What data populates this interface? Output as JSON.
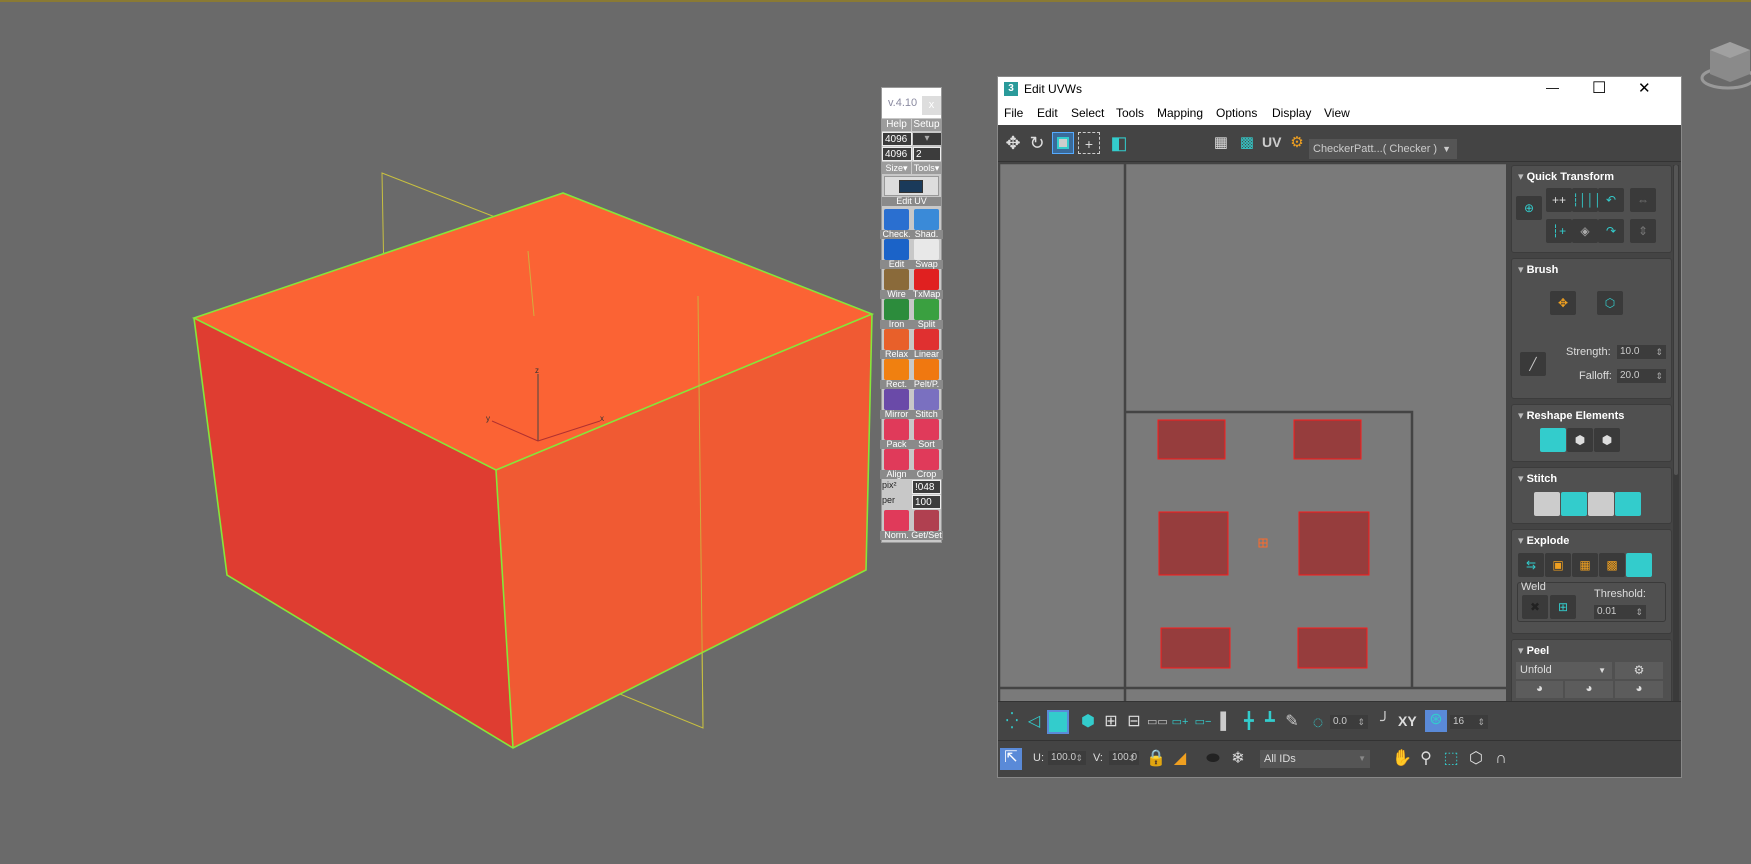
{
  "viewport": {
    "axis_labels": {
      "z": "z",
      "x": "x",
      "y": "y"
    },
    "box_color": "#f26036",
    "edge_color": "#7ee23a"
  },
  "plugin_toolbar": {
    "version": "v.4.10",
    "close": "x",
    "help": "Help",
    "setup": "Setup",
    "width_value": "4096",
    "height_value": "4096",
    "extra_value": "2",
    "size": "Size▾",
    "tools": "Tools▾",
    "edit_uv": "Edit  UV",
    "tools_grid": [
      {
        "label": "Check.",
        "icon": "checker-cube-icon",
        "color": "#2a6fd0"
      },
      {
        "label": "Shad.",
        "icon": "shaded-sphere-icon",
        "color": "#3a8ad8"
      },
      {
        "label": "Edit",
        "icon": "photoshop-icon",
        "color": "#1b63c8"
      },
      {
        "label": "Swap",
        "icon": "uv-3d-swap-icon",
        "color": "#e8e8e8"
      },
      {
        "label": "Wire",
        "icon": "clipboard-wire-icon",
        "color": "#8a6a3a"
      },
      {
        "label": "TxMap",
        "icon": "texmap-question-icon",
        "color": "#e02020"
      },
      {
        "label": "Iron",
        "icon": "iron-icon",
        "color": "#2c8c3c"
      },
      {
        "label": "Split",
        "icon": "split-icon",
        "color": "#3aa040"
      },
      {
        "label": "Relax",
        "icon": "relax-wave-icon",
        "color": "#e8602a"
      },
      {
        "label": "Linear",
        "icon": "linear-icon",
        "color": "#e03030"
      },
      {
        "label": "Rect.",
        "icon": "rectangle-icon",
        "color": "#f08010"
      },
      {
        "label": "Pelt/P.",
        "icon": "pelt-icon",
        "color": "#f07810"
      },
      {
        "label": "Mirror",
        "icon": "mirror-icon",
        "color": "#6a4aa8"
      },
      {
        "label": "Stitch",
        "icon": "stitch-icon",
        "color": "#7a70c0"
      },
      {
        "label": "Pack",
        "icon": "pack-icon",
        "color": "#e03a5a"
      },
      {
        "label": "Sort",
        "icon": "sort-icon",
        "color": "#e03a5a"
      },
      {
        "label": "Align",
        "icon": "align-icon",
        "color": "#e03a5a"
      },
      {
        "label": "Crop",
        "icon": "crop-icon",
        "color": "#e03a5a"
      }
    ],
    "pix_label": "pix²",
    "pix_value": "!048",
    "per_label": "per",
    "per_value": "100",
    "norm": "Norm.",
    "getset": "Get/Set"
  },
  "window": {
    "title": "Edit UVWs",
    "app_icon": "3",
    "controls": {
      "minimize": "—",
      "maximize": "☐",
      "close": "✕"
    },
    "menu": [
      "File",
      "Edit",
      "Select",
      "Tools",
      "Mapping",
      "Options",
      "Display",
      "View"
    ],
    "toolbar": {
      "uv_label": "UV",
      "texture_dropdown": "CheckerPatt...( Checker )"
    },
    "panel": {
      "quick_transform": "Quick Transform",
      "brush": "Brush",
      "strength_label": "Strength:",
      "strength": "10.0",
      "falloff_label": "Falloff:",
      "falloff": "20.0",
      "reshape": "Reshape Elements",
      "stitch": "Stitch",
      "explode": "Explode",
      "weld": "Weld",
      "threshold_label": "Threshold:",
      "threshold": "0.01",
      "peel": "Peel",
      "peel_mode": "Unfold"
    },
    "bottom": {
      "rotation_value": "0.0",
      "xy_label": "XY",
      "grid_value": "16",
      "u_label": "U:",
      "u_value": "100.0",
      "v_label": "V:",
      "v_value": "100.0",
      "id_filter": "All IDs"
    },
    "accent": "#3cc8c8"
  }
}
